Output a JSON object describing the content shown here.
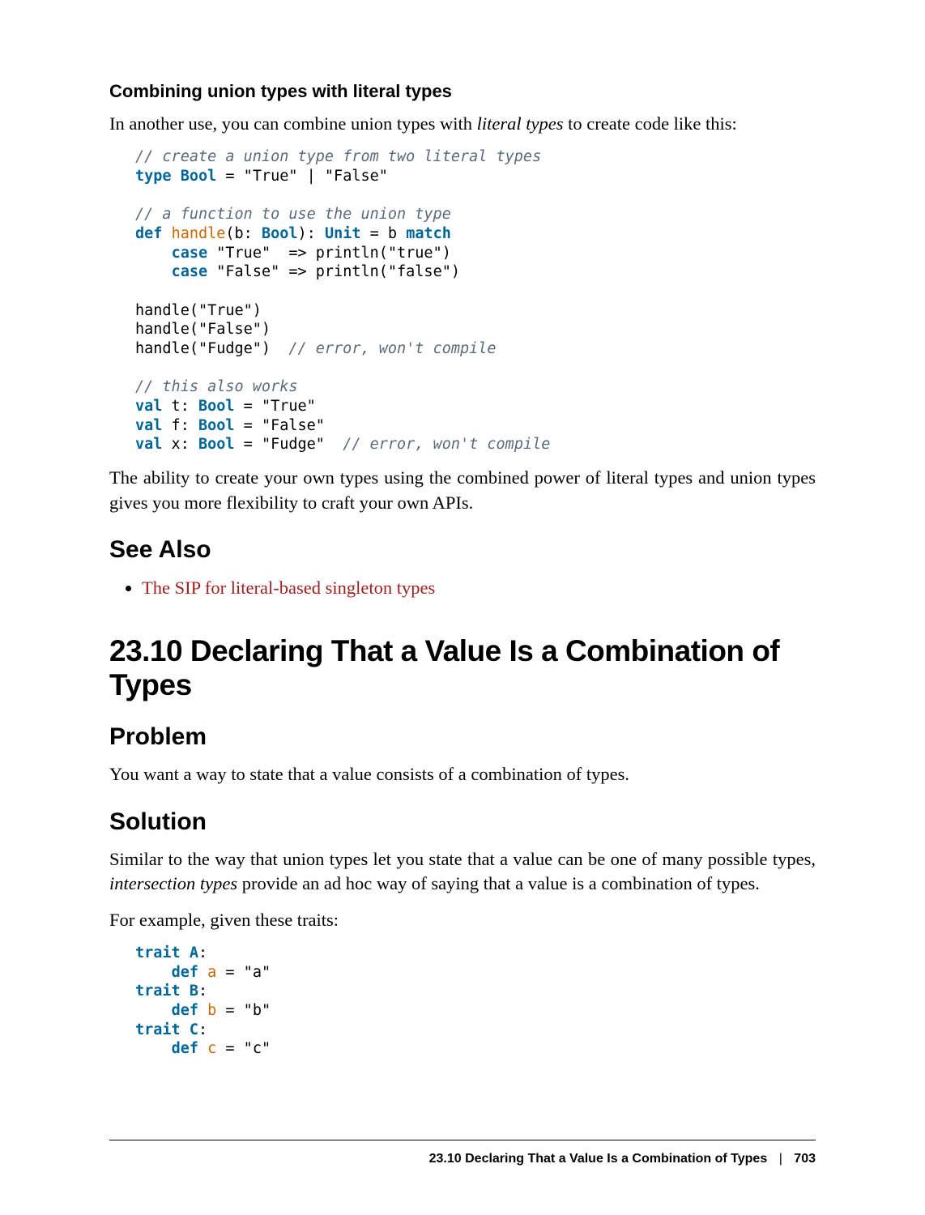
{
  "section_h4": "Combining union types with literal types",
  "p1_a": "In another use, you can combine union types with ",
  "p1_b": "literal types",
  "p1_c": " to create code like this:",
  "code1": {
    "l01a": "// create a union type from two literal types",
    "l02a": "type",
    "l02b": "Bool",
    "l02c": " = \"True\" | \"False\"",
    "l03": "",
    "l04a": "// a function to use the union type",
    "l05a": "def",
    "l05b": "handle",
    "l05c": "(b: ",
    "l05d": "Bool",
    "l05e": "): ",
    "l05f": "Unit",
    "l05g": " = b ",
    "l05h": "match",
    "l06a": "case",
    "l06b": " \"True\"  => println(\"true\")",
    "l07a": "case",
    "l07b": " \"False\" => println(\"false\")",
    "l08": "",
    "l09": "handle(\"True\")",
    "l10": "handle(\"False\")",
    "l11a": "handle(\"Fudge\")  ",
    "l11b": "// error, won't compile",
    "l12": "",
    "l13a": "// this also works",
    "l14a": "val",
    "l14b": " t: ",
    "l14c": "Bool",
    "l14d": " = \"True\"",
    "l15a": "val",
    "l15b": " f: ",
    "l15c": "Bool",
    "l15d": " = \"False\"",
    "l16a": "val",
    "l16b": " x: ",
    "l16c": "Bool",
    "l16d": " = \"Fudge\"  ",
    "l16e": "// error, won't compile"
  },
  "p2": "The ability to create your own types using the combined power of literal types and union types gives you more flexibility to craft your own APIs.",
  "see_also_h": "See Also",
  "see_also_link": "The SIP for literal-based singleton types",
  "main_h1": "23.10 Declaring That a Value Is a Combination of Types",
  "problem_h": "Problem",
  "problem_p": "You want a way to state that a value consists of a combination of types.",
  "solution_h": "Solution",
  "sol_p1_a": "Similar to the way that union types let you state that a value can be one of many possible types, ",
  "sol_p1_b": "intersection types",
  "sol_p1_c": " provide an ad hoc way of saying that a value is a combination of types.",
  "sol_p2": "For example, given these traits:",
  "code2": {
    "l1a": "trait",
    "l1b": "A",
    "l1c": ":",
    "l2a": "def",
    "l2b": "a",
    "l2c": " = \"a\"",
    "l3a": "trait",
    "l3b": "B",
    "l3c": ":",
    "l4a": "def",
    "l4b": "b",
    "l4c": " = \"b\"",
    "l5a": "trait",
    "l5b": "C",
    "l5c": ":",
    "l6a": "def",
    "l6b": "c",
    "l6c": " = \"c\""
  },
  "footer_title": "23.10 Declaring That a Value Is a Combination of Types",
  "footer_sep": "|",
  "footer_page": "703"
}
